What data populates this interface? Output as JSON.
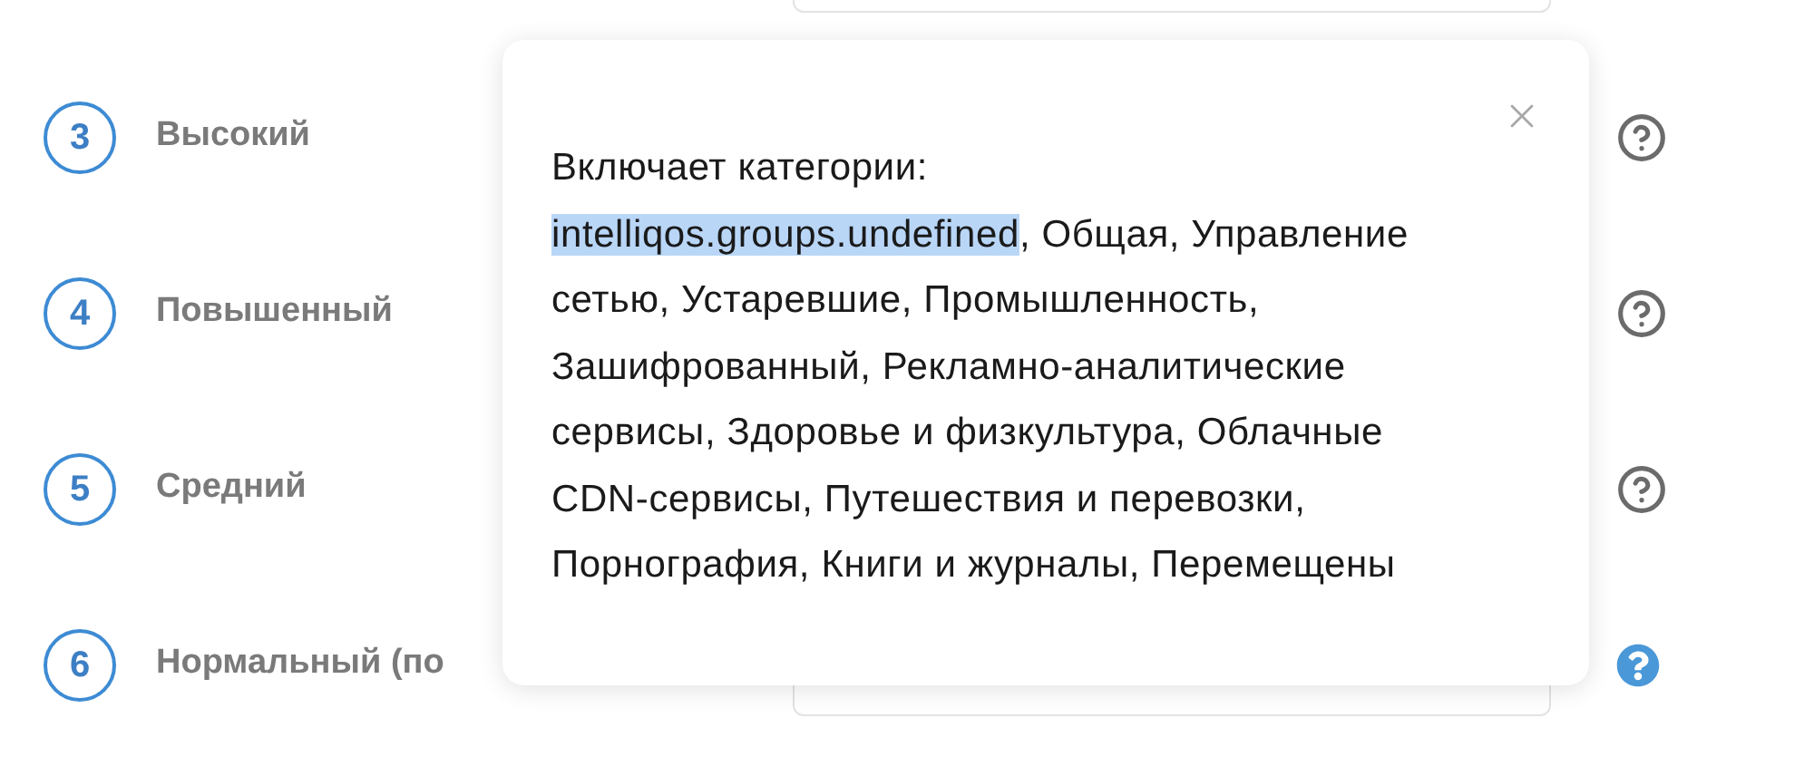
{
  "levels": [
    {
      "number": "3",
      "label": "Высокий",
      "help_selected": false
    },
    {
      "number": "4",
      "label": "Повышенный",
      "help_selected": false
    },
    {
      "number": "5",
      "label": "Средний",
      "help_selected": false
    },
    {
      "number": "6",
      "label": "Нормальный (по",
      "help_selected": true
    }
  ],
  "popover": {
    "title": "Включает категории:",
    "highlighted": "intelliqos.groups.undefined",
    "text": ", Общая, Управление сетью, Устаревшие, Промышленность, Зашифрованный, Рекламно-аналитические сервисы, Здоровье и физкультура, Облачные CDN-сервисы, Путешествия и перевозки, Порнография, Книги и журналы, Перемещены"
  }
}
